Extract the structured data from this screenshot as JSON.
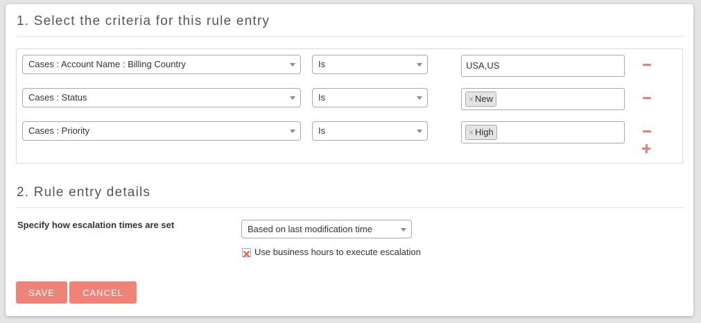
{
  "section1": {
    "title": "1. Select the criteria for this rule entry"
  },
  "criteria_rows": [
    {
      "field": "Cases : Account Name : Billing Country",
      "operator": "Is",
      "value_text": "USA,US"
    },
    {
      "field": "Cases : Status",
      "operator": "Is",
      "value_tag": "New"
    },
    {
      "field": "Cases : Priority",
      "operator": "Is",
      "value_tag": "High"
    }
  ],
  "tag_remove_glyph": "×",
  "section2": {
    "title": "2. Rule entry details",
    "escalation_label": "Specify how escalation times are set",
    "escalation_select": "Based on last modification time",
    "business_hours_label": "Use business hours to execute escalation"
  },
  "buttons": {
    "save": "SAVE",
    "cancel": "CANCEL"
  },
  "colors": {
    "accent": "#f08377",
    "icon": "#ef7d74"
  }
}
